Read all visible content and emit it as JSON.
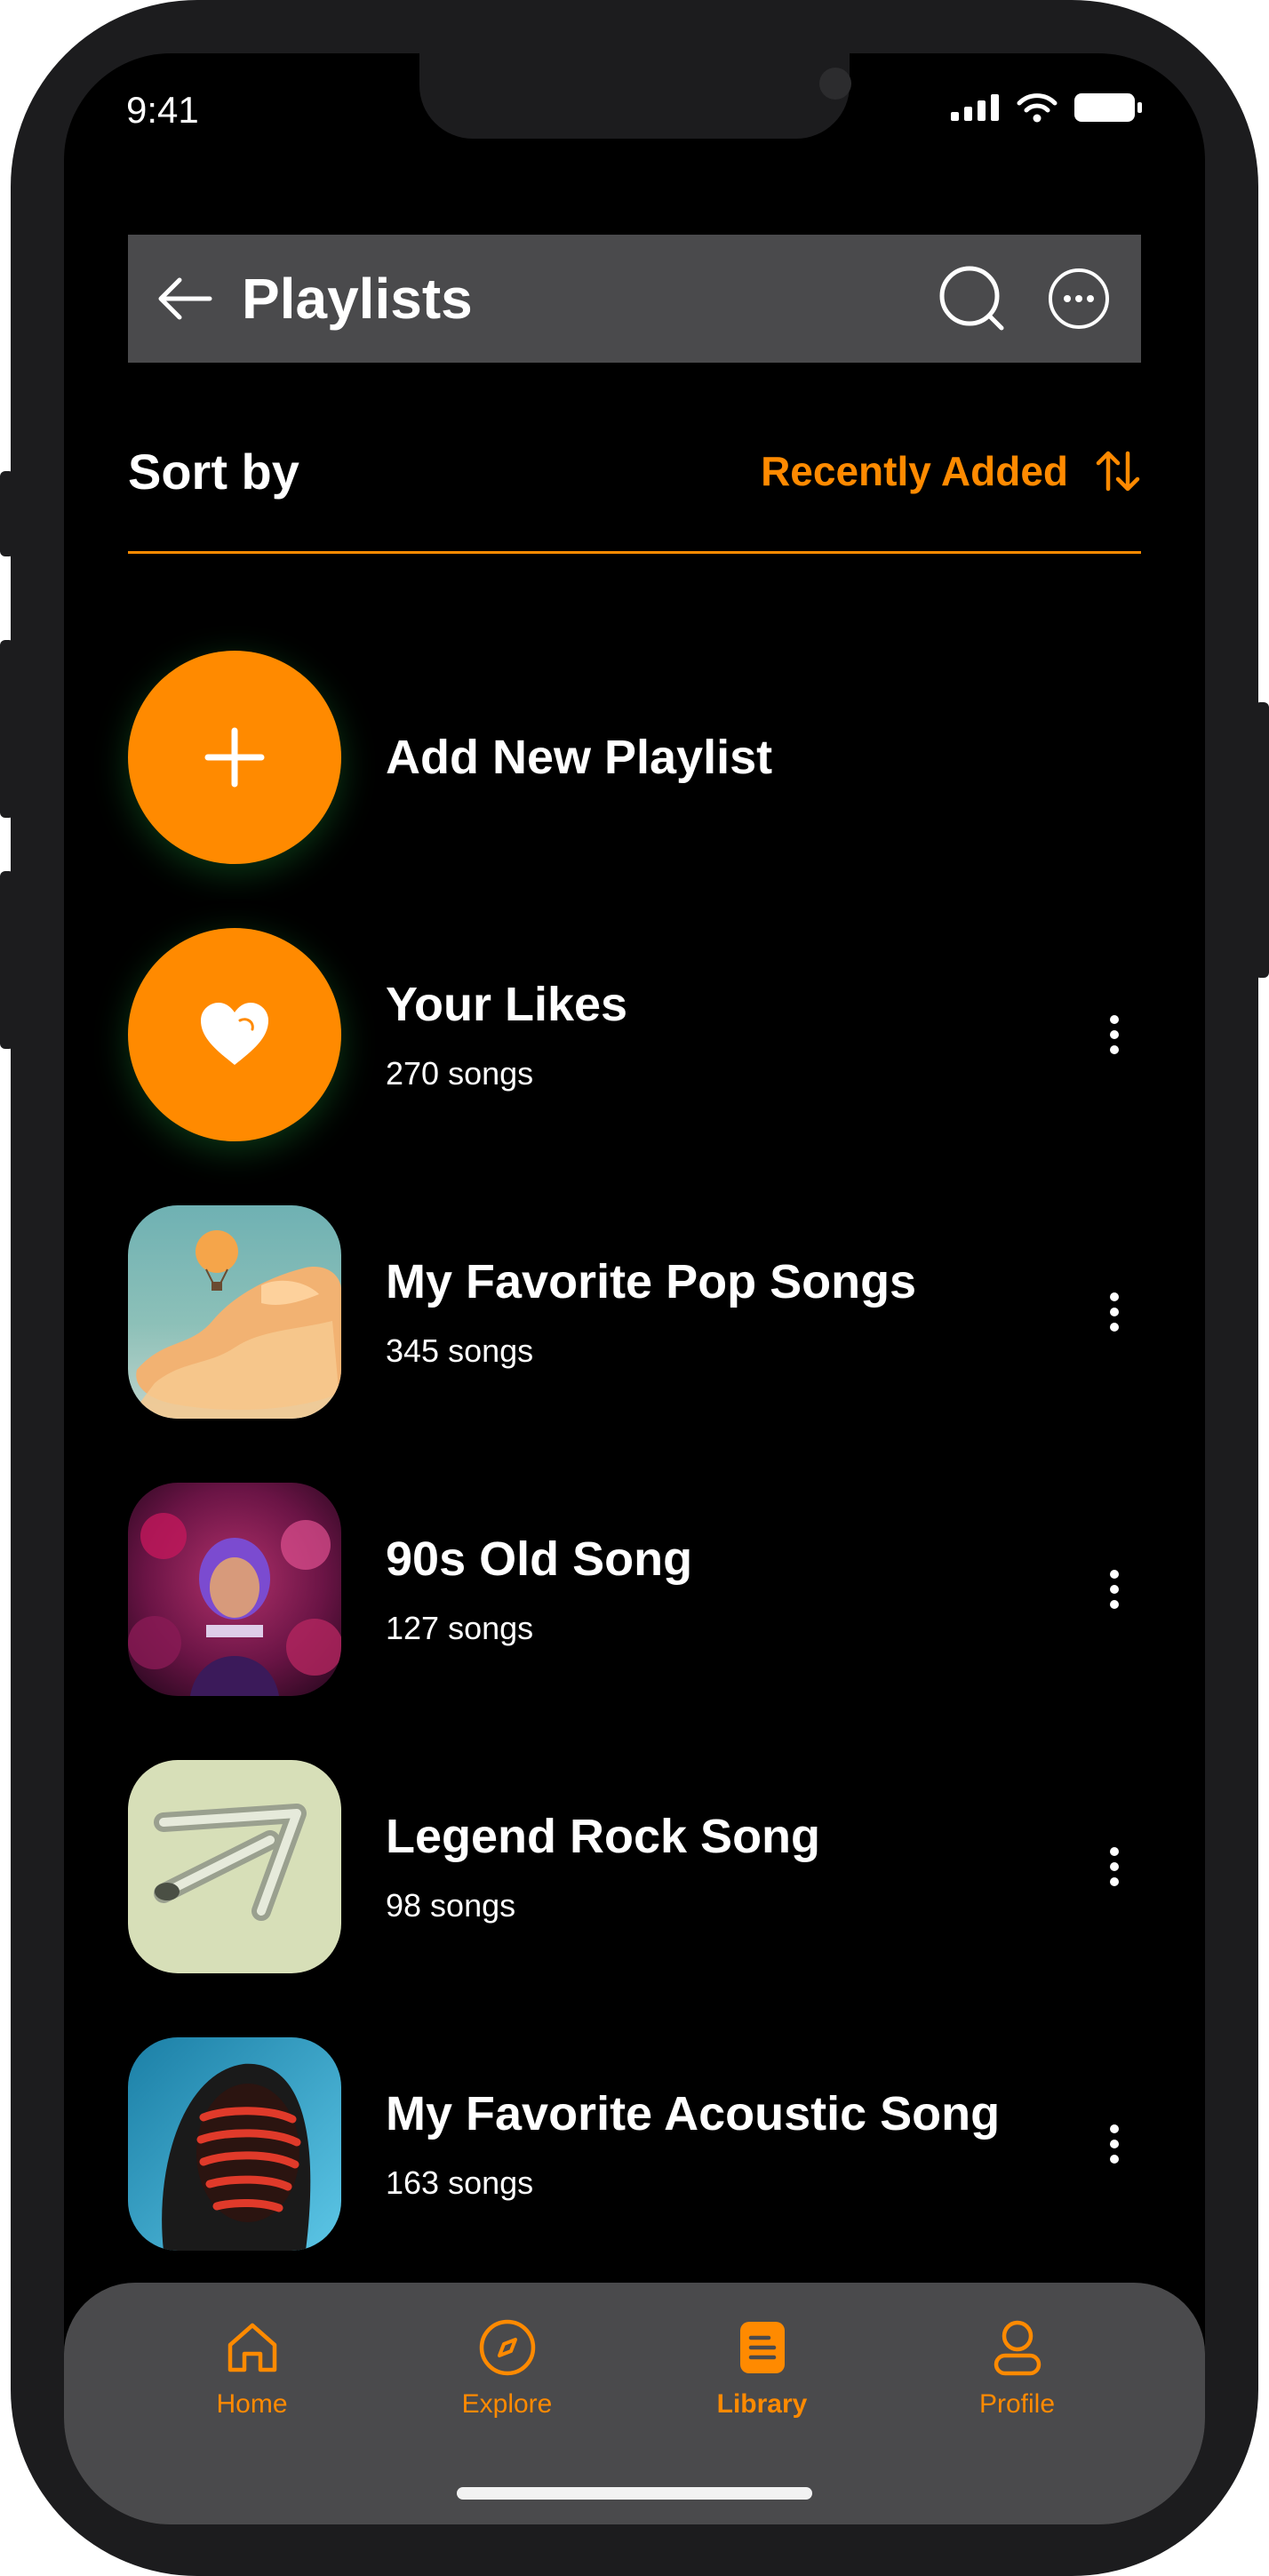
{
  "status_bar": {
    "time": "9:41"
  },
  "header": {
    "title": "Playlists"
  },
  "sort": {
    "label": "Sort by",
    "value": "Recently Added"
  },
  "add_playlist": {
    "label": "Add New Playlist"
  },
  "playlists": [
    {
      "title": "Your Likes",
      "subtitle": "270 songs",
      "icon": "heart-icon"
    },
    {
      "title": "My Favorite Pop Songs",
      "subtitle": "345 songs",
      "icon": "album-art"
    },
    {
      "title": "90s Old Song",
      "subtitle": "127 songs",
      "icon": "album-art"
    },
    {
      "title": "Legend Rock Song",
      "subtitle": "98 songs",
      "icon": "album-art"
    },
    {
      "title": "My Favorite Acoustic Song",
      "subtitle": "163 songs",
      "icon": "album-art"
    }
  ],
  "tabs": [
    {
      "label": "Home",
      "icon": "home-icon"
    },
    {
      "label": "Explore",
      "icon": "compass-icon"
    },
    {
      "label": "Library",
      "icon": "library-icon",
      "active": true
    },
    {
      "label": "Profile",
      "icon": "profile-icon"
    }
  ],
  "colors": {
    "accent": "#ff8a00",
    "background": "#000000",
    "surface": "#4a4a4c"
  }
}
